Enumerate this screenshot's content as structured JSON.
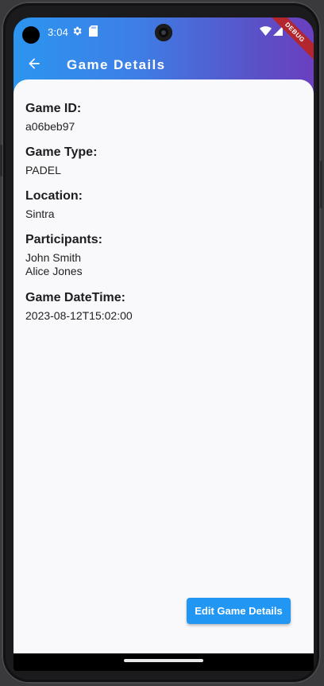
{
  "status_bar": {
    "time": "3:04",
    "debug_banner": "DEBUG"
  },
  "app_bar": {
    "title": "Game Details"
  },
  "details": [
    {
      "label": "Game ID:",
      "value": "a06beb97"
    },
    {
      "label": "Game Type:",
      "value": "PADEL"
    },
    {
      "label": "Location:",
      "value": "Sintra"
    },
    {
      "label": "Participants:",
      "values": [
        "John Smith",
        "Alice Jones"
      ]
    },
    {
      "label": "Game DateTime:",
      "value": "2023-08-12T15:02:00"
    }
  ],
  "actions": {
    "edit_label": "Edit Game Details"
  },
  "colors": {
    "accent": "#2196f3",
    "background": "#f9f9fb",
    "debug": "#b3262d"
  },
  "icons": [
    "back-arrow-icon",
    "settings-gear-icon",
    "sd-card-icon",
    "wifi-icon",
    "cell-signal-icon"
  ]
}
